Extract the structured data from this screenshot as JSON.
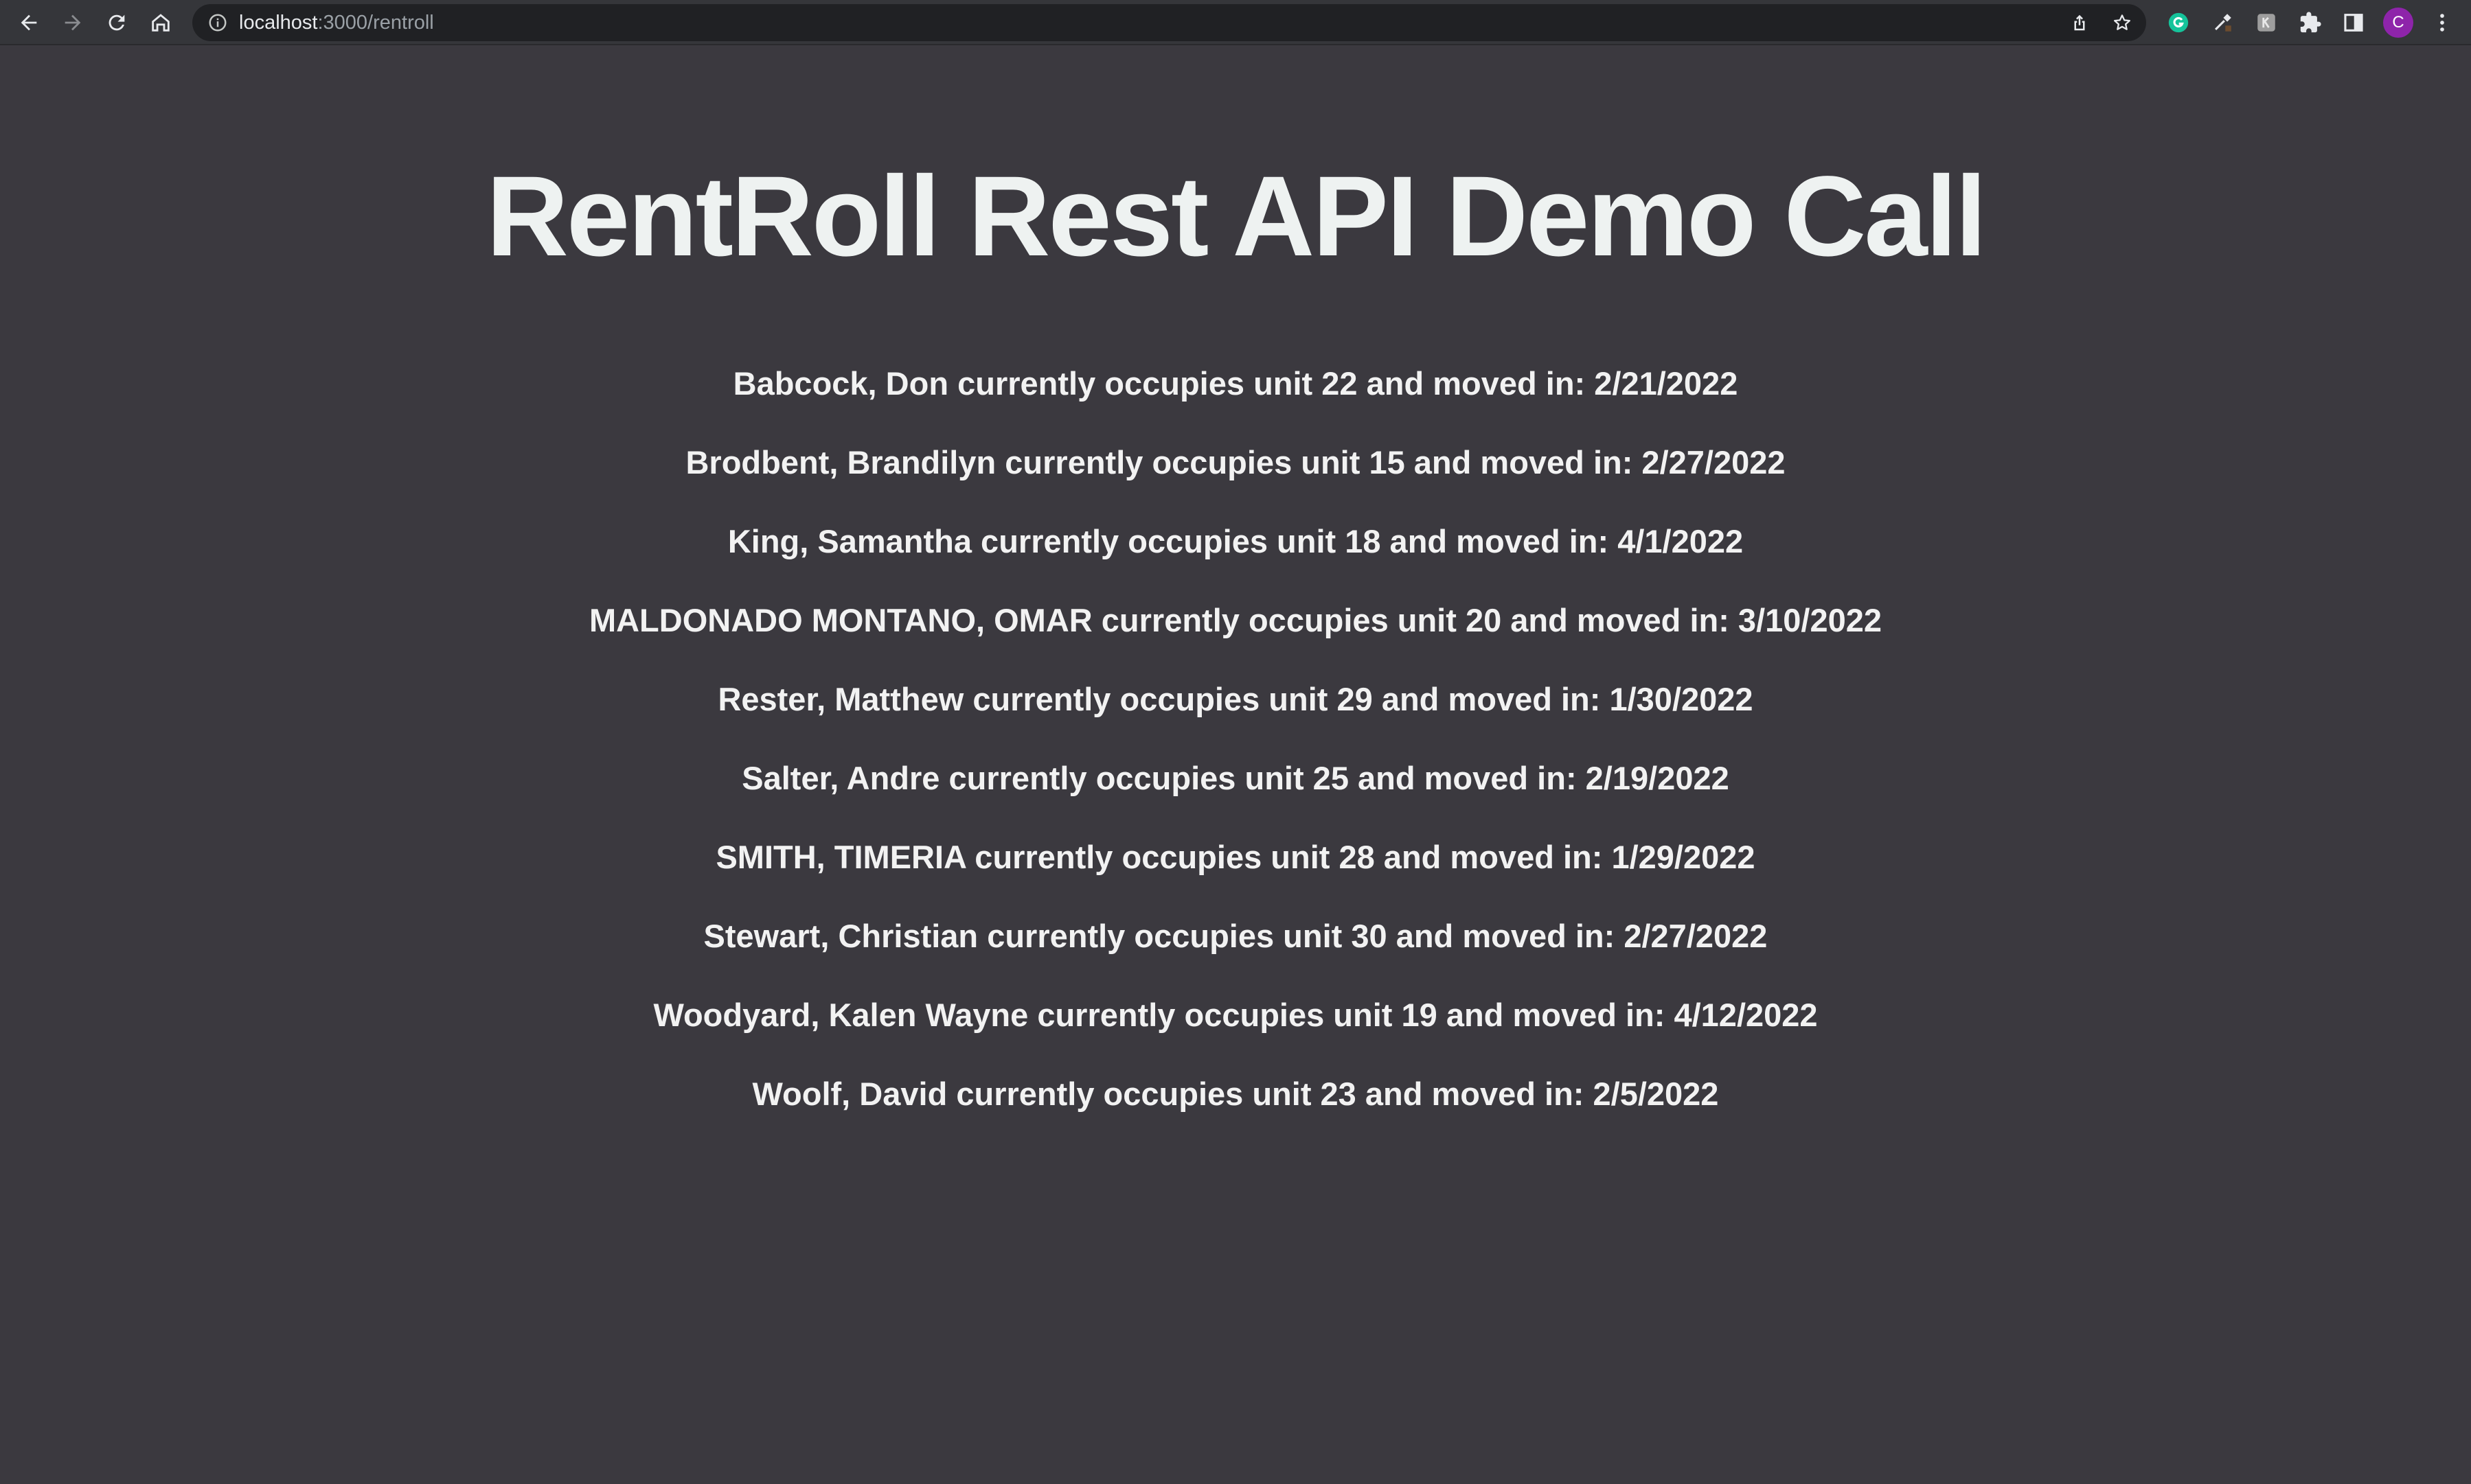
{
  "browser": {
    "url_host": "localhost",
    "url_path": ":3000/rentroll",
    "profile_initial": "C"
  },
  "page": {
    "title": "RentRoll Rest API Demo Call"
  },
  "tenants": [
    "Babcock, Don currently occupies unit 22 and moved in: 2/21/2022",
    "Brodbent, Brandilyn currently occupies unit 15 and moved in: 2/27/2022",
    "King, Samantha currently occupies unit 18 and moved in: 4/1/2022",
    "MALDONADO MONTANO, OMAR currently occupies unit 20 and moved in: 3/10/2022",
    "Rester, Matthew currently occupies unit 29 and moved in: 1/30/2022",
    "Salter, Andre currently occupies unit 25 and moved in: 2/19/2022",
    "SMITH, TIMERIA currently occupies unit 28 and moved in: 1/29/2022",
    "Stewart, Christian currently occupies unit 30 and moved in: 2/27/2022",
    "Woodyard, Kalen Wayne currently occupies unit 19 and moved in: 4/12/2022",
    "Woolf, David currently occupies unit 23 and moved in: 2/5/2022"
  ],
  "colors": {
    "page_background": "#3b393f",
    "title_text": "#eef2f1",
    "row_text": "#f2f2f2",
    "toolbar_background": "#35363a",
    "omnibox_background": "#202124",
    "avatar_background": "#8e24aa"
  },
  "icons": {
    "toolbar": [
      "back-arrow-icon",
      "forward-arrow-icon",
      "reload-icon",
      "home-icon"
    ],
    "omnibox": [
      "info-icon",
      "share-icon",
      "bookmark-star-icon"
    ],
    "extensions": [
      "grammarly-icon",
      "eyedropper-icon",
      "k-extension-icon",
      "puzzle-icon",
      "side-panel-icon",
      "kebab-menu-icon"
    ]
  }
}
